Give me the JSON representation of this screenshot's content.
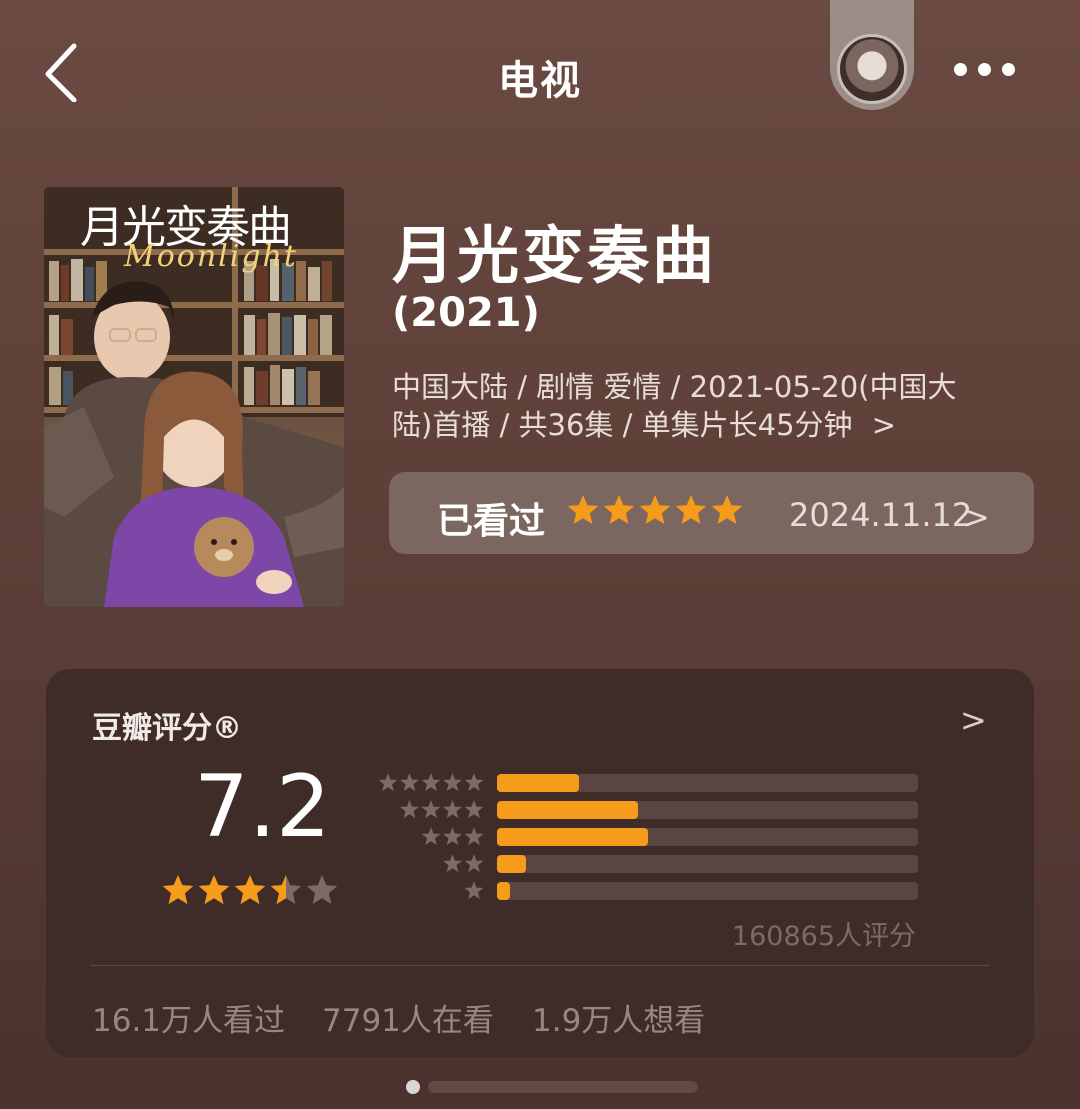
{
  "header": {
    "title": "电视",
    "back_icon": "chevron-left-icon",
    "more_icon": "more-horizontal-icon"
  },
  "poster": {
    "title_text": "月光变奏曲",
    "subtitle_text": "Moonlight"
  },
  "show": {
    "title": "月光变奏曲",
    "year": "(2021)",
    "meta_line1": "中国大陆 / 剧情 爱情 / 2021-05-20(中国大",
    "meta_line2": "陆)首播 / 共36集 / 单集片长45分钟",
    "meta_chevron": ">"
  },
  "watched": {
    "label": "已看过",
    "my_rating_stars": 5,
    "date": "2024.11.12",
    "chevron": ">"
  },
  "rating": {
    "label": "豆瓣评分®",
    "chevron": ">",
    "score": "7.2",
    "score_stars": 3.5,
    "distribution": [
      {
        "stars": 5,
        "fraction": 0.195
      },
      {
        "stars": 4,
        "fraction": 0.335
      },
      {
        "stars": 3,
        "fraction": 0.358
      },
      {
        "stars": 2,
        "fraction": 0.068
      },
      {
        "stars": 1,
        "fraction": 0.03
      }
    ],
    "count_text": "160865人评分",
    "stats": {
      "watched": "16.1万人看过",
      "watching": "7791人在看",
      "want": "1.9万人想看"
    }
  },
  "colors": {
    "star": "#f59c1a",
    "star_empty": "#7b6a65",
    "card": "#3f2b27"
  }
}
